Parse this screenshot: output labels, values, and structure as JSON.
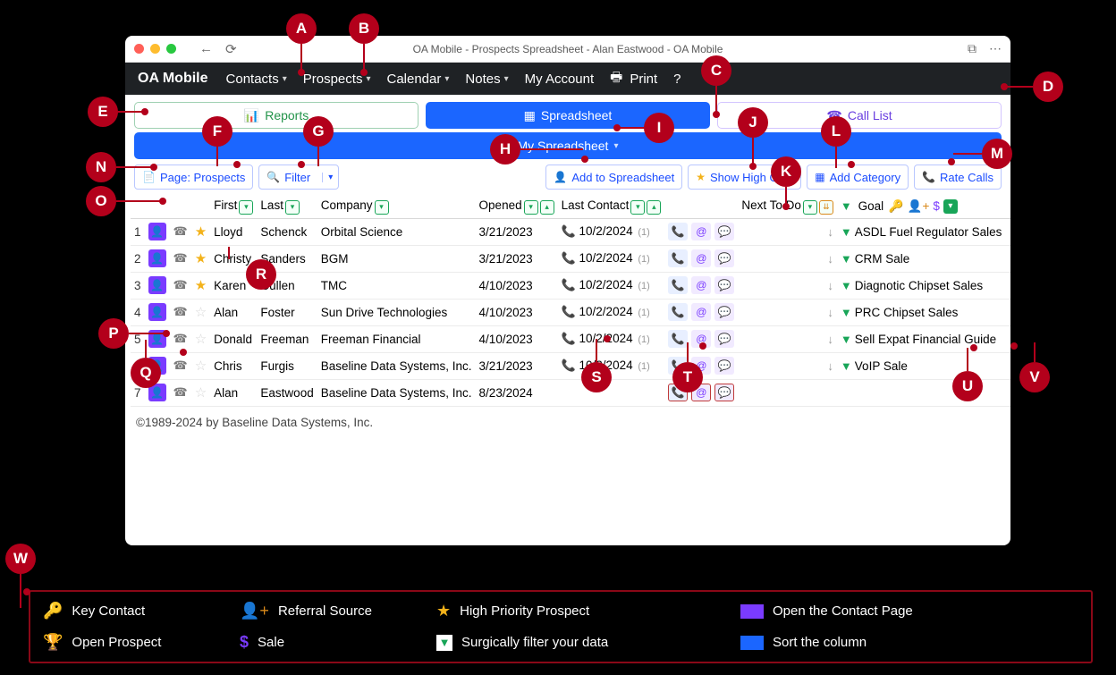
{
  "title": "OA Mobile - Prospects Spreadsheet - Alan Eastwood - OA Mobile",
  "brand": "OA Mobile",
  "menu": {
    "contacts": "Contacts",
    "prospects": "Prospects",
    "calendar": "Calendar",
    "notes": "Notes",
    "account": "My Account",
    "print": "Print",
    "help": "?"
  },
  "tabs": {
    "reports": "Reports",
    "spreadsheet": "Spreadsheet",
    "calllist": "Call List"
  },
  "sheetbar": "My Spreadsheet",
  "buttons": {
    "page": "Page: Prospects",
    "filter": "Filter",
    "add": "Add to Spreadsheet",
    "high": "Show High Only",
    "cat": "Add Category",
    "rate": "Rate Calls"
  },
  "columns": {
    "first": "First",
    "last": "Last",
    "company": "Company",
    "opened": "Opened",
    "lastcontact": "Last Contact",
    "nexttodo": "Next To Do",
    "goal": "Goal"
  },
  "rows": [
    {
      "n": "1",
      "star": true,
      "first": "Lloyd",
      "last": "Schenck",
      "company": "Orbital Science",
      "opened": "3/21/2023",
      "contact": "10/2/2024",
      "cnt": "(1)",
      "goal": "ASDL Fuel Regulator Sales"
    },
    {
      "n": "2",
      "star": true,
      "first": "Christy",
      "last": "Sanders",
      "company": "BGM",
      "opened": "3/21/2023",
      "contact": "10/2/2024",
      "cnt": "(1)",
      "goal": "CRM Sale"
    },
    {
      "n": "3",
      "star": true,
      "first": "Karen",
      "last": "Cullen",
      "company": "TMC",
      "opened": "4/10/2023",
      "contact": "10/2/2024",
      "cnt": "(1)",
      "goal": "Diagnotic Chipset Sales"
    },
    {
      "n": "4",
      "star": false,
      "first": "Alan",
      "last": "Foster",
      "company": "Sun Drive Technologies",
      "opened": "4/10/2023",
      "contact": "10/2/2024",
      "cnt": "(1)",
      "goal": "PRC Chipset Sales"
    },
    {
      "n": "5",
      "star": false,
      "first": "Donald",
      "last": "Freeman",
      "company": "Freeman Financial",
      "opened": "4/10/2023",
      "contact": "10/2/2024",
      "cnt": "(1)",
      "goal": "Sell Expat Financial Guide"
    },
    {
      "n": "6",
      "star": false,
      "first": "Chris",
      "last": "Furgis",
      "company": "Baseline Data Systems, Inc.",
      "opened": "3/21/2023",
      "contact": "10/2/2024",
      "cnt": "(1)",
      "goal": "VoIP Sale"
    },
    {
      "n": "7",
      "star": false,
      "first": "Alan",
      "last": "Eastwood",
      "company": "Baseline Data Systems, Inc.",
      "opened": "8/23/2024",
      "contact": "",
      "cnt": "",
      "goal": ""
    }
  ],
  "footer": "©1989-2024 by Baseline Data Systems, Inc.",
  "annotations": {
    "A": "A",
    "B": "B",
    "C": "C",
    "D": "D",
    "E": "E",
    "F": "F",
    "G": "G",
    "H": "H",
    "I": "I",
    "J": "J",
    "K": "K",
    "L": "L",
    "M": "M",
    "N": "N",
    "O": "O",
    "P": "P",
    "Q": "Q",
    "R": "R",
    "S": "S",
    "T": "T",
    "U": "U",
    "V": "V",
    "W": "W"
  },
  "legend": {
    "key": "Key Contact",
    "referral": "Referral Source",
    "high": "High Priority Prospect",
    "open": "Open Prospect",
    "sale": "Sale",
    "filter": "Surgically filter your data",
    "color1": "Open the Contact Page",
    "color2": "Sort the column"
  }
}
